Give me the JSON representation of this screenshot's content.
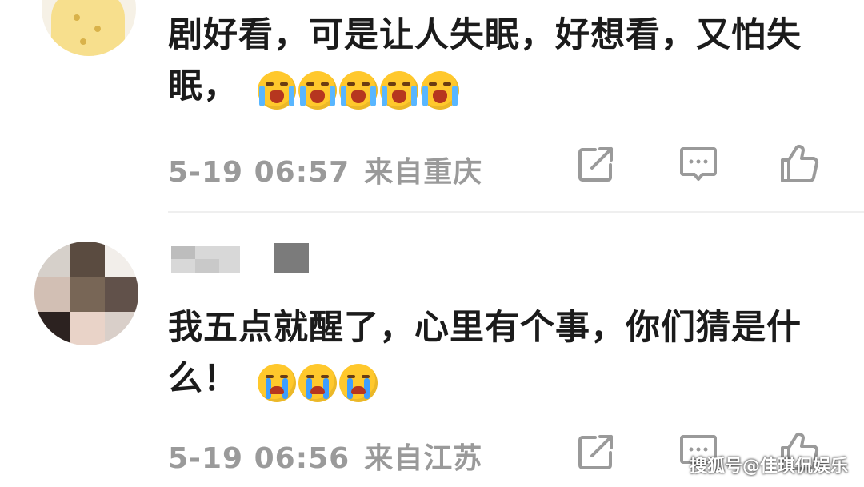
{
  "comments": [
    {
      "text": "剧好看，可是让人失眠，好想看，又怕失眠，",
      "emoji": "laughing-tears",
      "emoji_count": 5,
      "time": "5-19 06:57",
      "location": "来自重庆"
    },
    {
      "text": "我五点就醒了，心里有个事，你们猜是什么！",
      "emoji": "crying",
      "emoji_count": 3,
      "time": "5-19 06:56",
      "location": "来自江苏"
    }
  ],
  "actions": {
    "share_icon": "share-icon",
    "reply_icon": "comment-icon",
    "like_icon": "thumbs-up-icon"
  },
  "watermark": "搜狐号@佳琪侃娱乐",
  "colors": {
    "text": "#1b1b1b",
    "meta": "#9a9a9a",
    "icon": "#9a9a9a",
    "emoji": "#ffc82c"
  }
}
